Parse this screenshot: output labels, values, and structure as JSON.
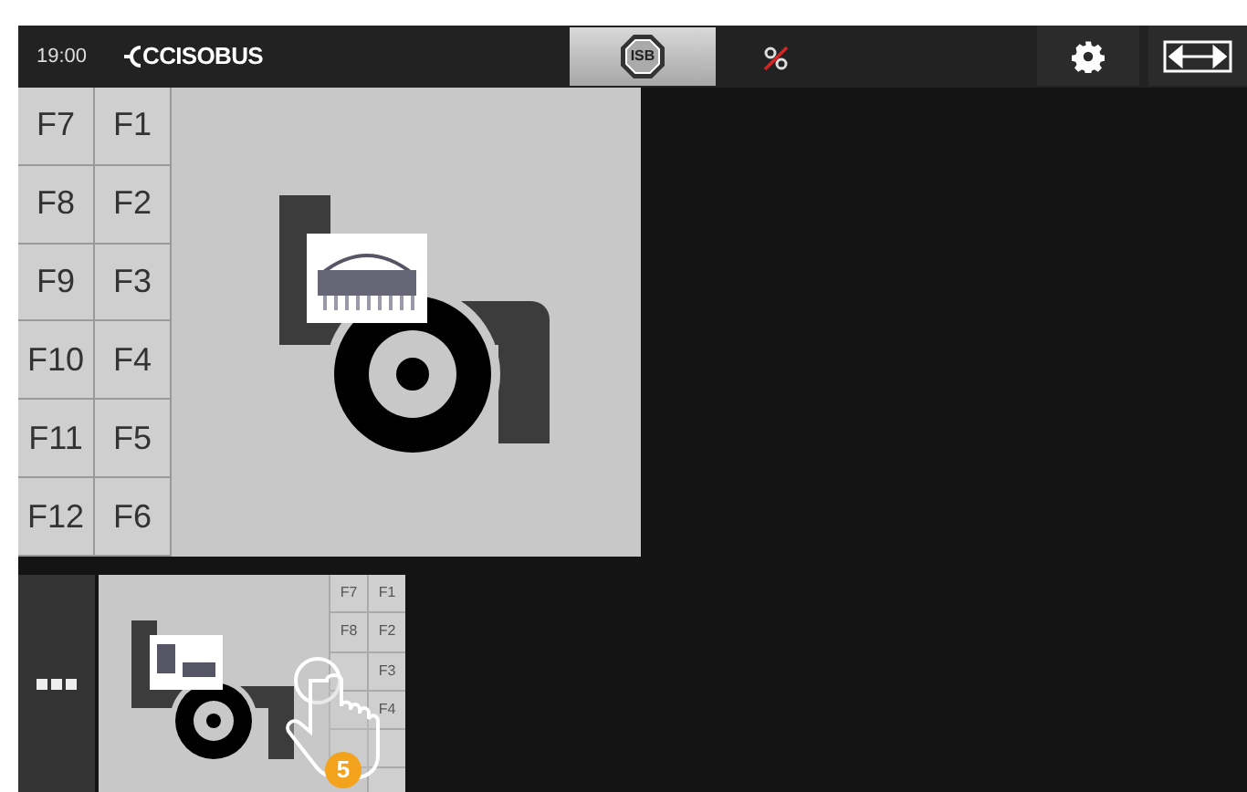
{
  "top_bar": {
    "time": "19:00",
    "logo": "CCISOBUS",
    "isb_button": "ISB"
  },
  "function_keys": {
    "left": [
      "F7",
      "F8",
      "F9",
      "F10",
      "F11",
      "F12"
    ],
    "right": [
      "F1",
      "F2",
      "F3",
      "F4",
      "F5",
      "F6"
    ]
  },
  "mini_panel": {
    "function_keys": {
      "left": [
        "F7",
        "F8"
      ],
      "right": [
        "F1",
        "F2",
        "F3",
        "F4"
      ]
    },
    "gesture_badge": "5"
  }
}
